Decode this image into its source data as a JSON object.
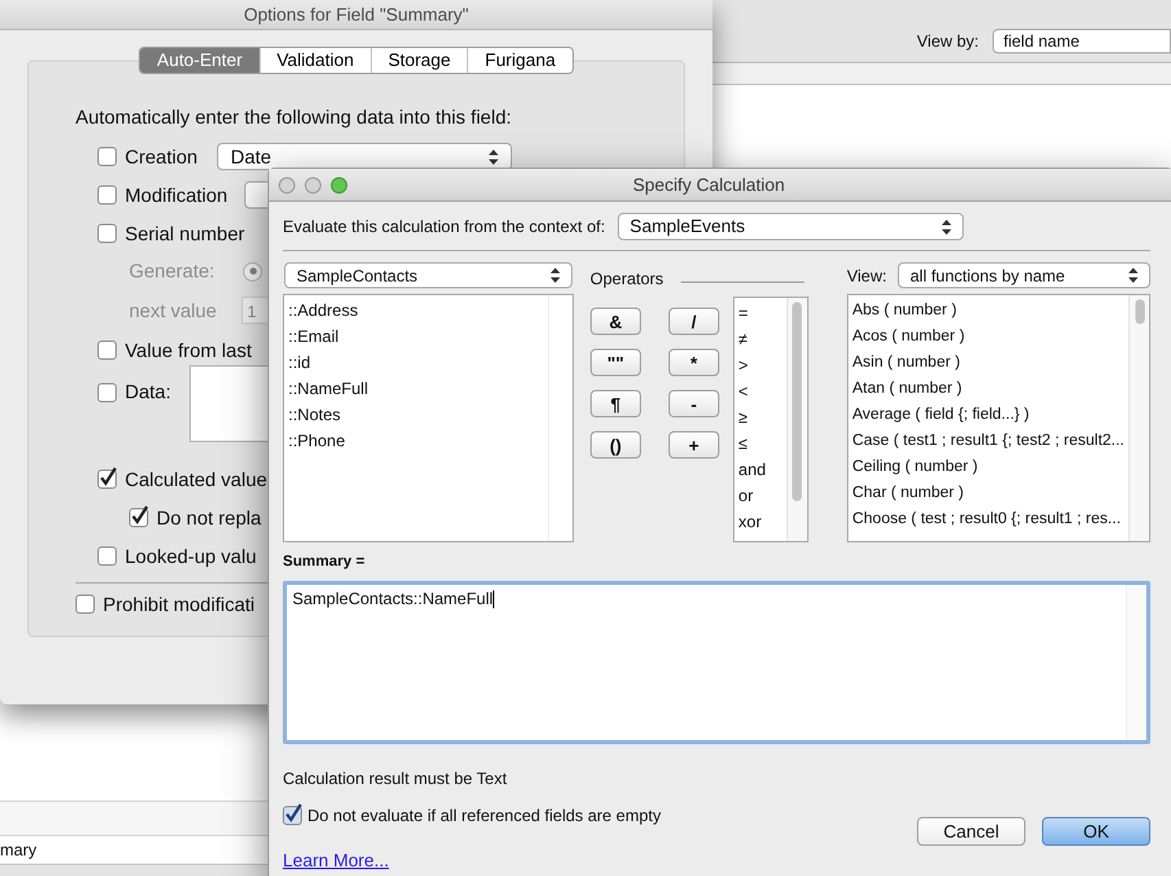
{
  "background_window": {
    "view_by_label": "View by:",
    "view_by_value": "field name",
    "name_field_value": "mary"
  },
  "options_dialog": {
    "title": "Options for Field \"Summary\"",
    "tabs": [
      {
        "label": "Auto-Enter",
        "selected": true
      },
      {
        "label": "Validation",
        "selected": false
      },
      {
        "label": "Storage",
        "selected": false
      },
      {
        "label": "Furigana",
        "selected": false
      }
    ],
    "intro": "Automatically enter the following data into this field:",
    "options": [
      {
        "kind": "checkbox_dropdown",
        "label": "Creation",
        "checked": false,
        "value": "Date"
      },
      {
        "kind": "checkbox_dropdown",
        "label": "Modification",
        "checked": false
      },
      {
        "kind": "checkbox",
        "label": "Serial number",
        "checked": false,
        "children": [
          {
            "kind": "radio_row",
            "label": "Generate:",
            "selected": true
          },
          {
            "kind": "field_row",
            "label": "next value",
            "value": "1"
          }
        ]
      },
      {
        "kind": "checkbox",
        "label": "Value from last",
        "checked": false
      },
      {
        "kind": "checkbox_textbox",
        "label": "Data:",
        "checked": false
      },
      {
        "kind": "checkbox",
        "label": "Calculated value",
        "checked": true,
        "children": [
          {
            "kind": "checkbox",
            "label": "Do not repla",
            "checked": true
          }
        ]
      },
      {
        "kind": "checkbox",
        "label": "Looked-up valu",
        "checked": false
      }
    ],
    "prohibit": {
      "label": "Prohibit modificati",
      "checked": false
    }
  },
  "calc_dialog": {
    "title": "Specify Calculation",
    "context_label": "Evaluate this calculation from the context of:",
    "context_value": "SampleEvents",
    "table_value": "SampleContacts",
    "operators_label": "Operators",
    "view_label": "View:",
    "view_value": "all functions by name",
    "fields": [
      "::Address",
      "::Email",
      "::id",
      "::NameFull",
      "::Notes",
      "::Phone"
    ],
    "operator_buttons": [
      "&",
      "/",
      "\"\"",
      "*",
      "¶",
      "-",
      "()",
      "+"
    ],
    "operators": [
      "=",
      "≠",
      ">",
      "<",
      "≥",
      "≤",
      "and",
      "or",
      "xor"
    ],
    "functions": [
      "Abs ( number )",
      "Acos ( number )",
      "Asin ( number )",
      "Atan ( number )",
      "Average ( field {; field...} )",
      "Case ( test1 ; result1 {; test2 ; result2...",
      "Ceiling ( number )",
      "Char ( number )",
      "Choose ( test ; result0 {; result1 ; res..."
    ],
    "formula_label": "Summary =",
    "formula": "SampleContacts::NameFull",
    "result_note": "Calculation result must be Text",
    "no_evaluate": {
      "label": "Do not evaluate if all referenced fields are empty",
      "checked": true
    },
    "learn_more": "Learn More...",
    "buttons": [
      {
        "label": "Cancel",
        "kind": "normal"
      },
      {
        "label": "OK",
        "kind": "default"
      }
    ]
  }
}
